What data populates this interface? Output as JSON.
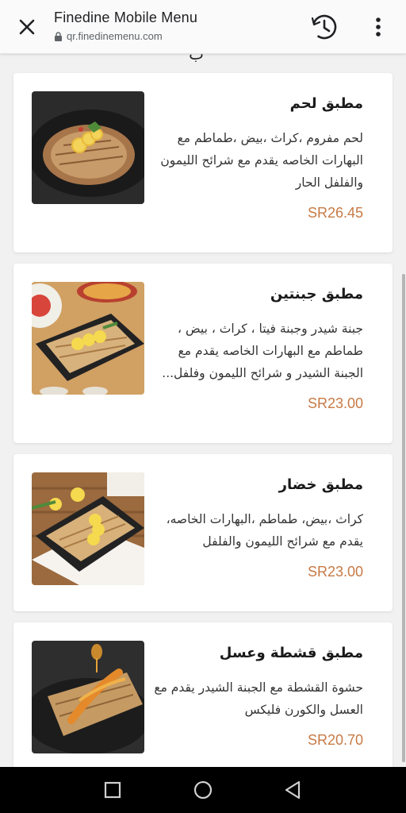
{
  "browser": {
    "title": "Finedine Mobile Menu",
    "url": "qr.finedinemenu.com",
    "icons": {
      "close": "close-icon",
      "lock": "lock-icon",
      "history": "history-icon",
      "more": "more-vert-icon"
    }
  },
  "section_heading_partial": "ب",
  "menu": {
    "items": [
      {
        "name": "مطبق لحم",
        "description": "لحم مفروم ،كراث ،بيض ،طماطم مع البهارات الخاصه يقدم مع شرائح الليمون والفلفل الحار",
        "price": "SR26.45"
      },
      {
        "name": "مطبق جبنتين",
        "description": "جبنة شيدر وجبنة فيتا ، كراث ، بيض ، طماطم مع البهارات الخاصه يقدم مع الجبنة الشيدر و شرائح الليمون وفلفل...",
        "price": "SR23.00"
      },
      {
        "name": "مطبق خضار",
        "description": "كراث ،بيض، طماطم ،البهارات الخاصه، يقدم مع شرائح الليمون والفلفل",
        "price": "SR23.00"
      },
      {
        "name": "مطبق قشطة وعسل",
        "description": "حشوة القشطة مع الجبنة الشيدر يقدم مع العسل والكورن فليكس",
        "price": "SR20.70"
      }
    ]
  },
  "navbar": {
    "icons": [
      "recents-square-icon",
      "home-circle-icon",
      "back-triangle-icon"
    ]
  },
  "colors": {
    "price": "#c77a46",
    "background": "#f1f1f1",
    "card": "#ffffff"
  }
}
